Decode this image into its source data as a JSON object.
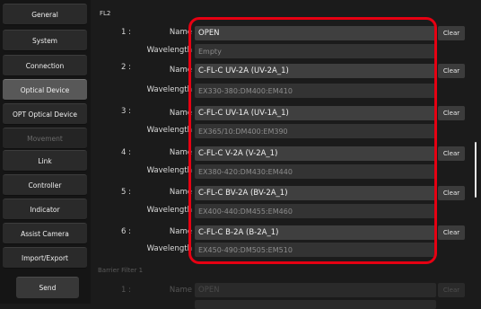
{
  "sidebar": {
    "items": [
      {
        "label": "General"
      },
      {
        "label": "System"
      },
      {
        "label": "Connection"
      },
      {
        "label": "Optical Device"
      },
      {
        "label": "OPT Optical Device"
      },
      {
        "label": "Movement"
      },
      {
        "label": "Link"
      },
      {
        "label": "Controller"
      },
      {
        "label": "Indicator"
      },
      {
        "label": "Assist Camera"
      },
      {
        "label": "Import/Export"
      }
    ],
    "active_item": "Optical Device",
    "disabled_item": "Movement",
    "send_label": "Send"
  },
  "section": {
    "title": "FL2",
    "name_label": "Name",
    "wavelength_label": "Wavelength",
    "clear_label": "Clear",
    "rows": [
      {
        "index": "1 :",
        "name": "OPEN",
        "wavelength": "Empty"
      },
      {
        "index": "2 :",
        "name": "C-FL-C UV-2A (UV-2A_1)",
        "wavelength": "EX330-380:DM400:EM410"
      },
      {
        "index": "3 :",
        "name": "C-FL-C UV-1A (UV-1A_1)",
        "wavelength": "EX365/10:DM400:EM390"
      },
      {
        "index": "4 :",
        "name": "C-FL-C V-2A (V-2A_1)",
        "wavelength": "EX380-420:DM430:EM440"
      },
      {
        "index": "5 :",
        "name": "C-FL-C BV-2A (BV-2A_1)",
        "wavelength": "EX400-440:DM455:EM460"
      },
      {
        "index": "6 :",
        "name": "C-FL-C B-2A (B-2A_1)",
        "wavelength": "EX450-490:DM505:EM510"
      }
    ]
  },
  "next_section": {
    "title": "Barrier Filter 1",
    "index": "1 :",
    "name_label": "Name",
    "name_value": "OPEN",
    "clear_label": "Clear"
  },
  "colors": {
    "highlight": "#e60012",
    "active_nav": "#585858",
    "background": "#1b1b1b"
  }
}
